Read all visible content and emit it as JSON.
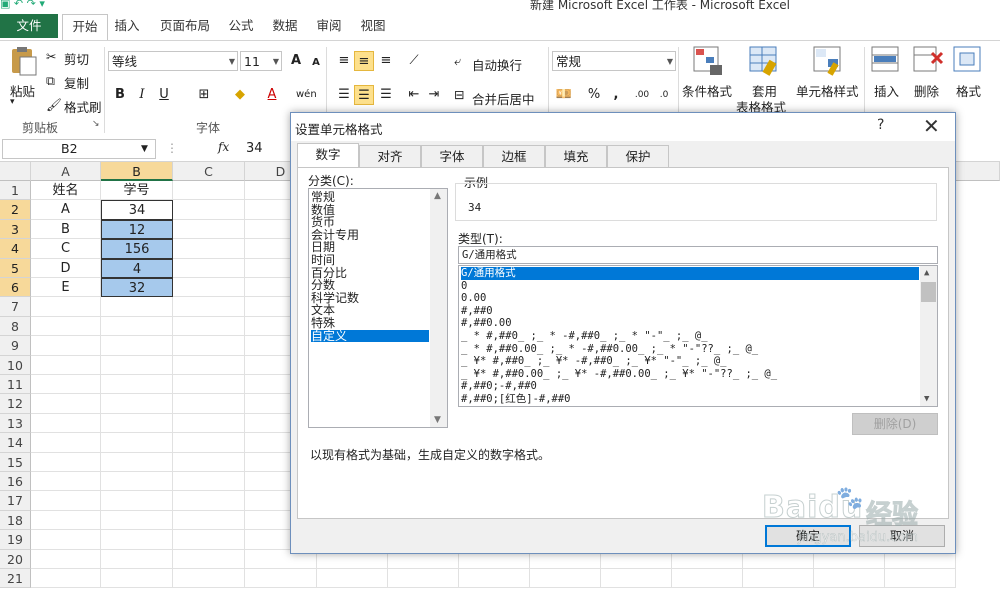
{
  "window": {
    "title": "新建 Microsoft Excel 工作表 - Microsoft Excel"
  },
  "tabs": [
    "文件",
    "开始",
    "插入",
    "页面布局",
    "公式",
    "数据",
    "审阅",
    "视图"
  ],
  "ribbon": {
    "clipboard": {
      "paste": "粘贴",
      "cut": "剪切",
      "copy": "复制",
      "format_painter": "格式刷",
      "group": "剪贴板"
    },
    "font": {
      "name": "等线",
      "size": "11",
      "bold": "B",
      "italic": "I",
      "underline": "U",
      "grow": "A",
      "shrink": "A",
      "font_color": "A",
      "phonetic": "wén",
      "group": "字体"
    },
    "alignment": {
      "wrap": "自动换行",
      "merge": "合并后居中"
    },
    "number": {
      "format": "常规",
      "percent": "%",
      "comma": ","
    },
    "styles": {
      "conditional": "条件格式",
      "table_line1": "套用",
      "table_line2": "表格格式",
      "cell_styles": "单元格样式"
    },
    "cells": {
      "insert": "插入",
      "delete": "删除",
      "format": "格式"
    }
  },
  "formula_bar": {
    "name_box": "B2",
    "fx": "fx",
    "value": "34"
  },
  "sheet": {
    "columns": [
      "A",
      "B",
      "C",
      "D"
    ],
    "rows": [
      "1",
      "2",
      "3",
      "4",
      "5",
      "6",
      "7",
      "8",
      "9",
      "10",
      "11",
      "12",
      "13",
      "14",
      "15",
      "16",
      "17",
      "18",
      "19",
      "20",
      "21"
    ],
    "cells": [
      [
        "姓名",
        "学号"
      ],
      [
        "A",
        "34"
      ],
      [
        "B",
        "12"
      ],
      [
        "C",
        "156"
      ],
      [
        "D",
        "4"
      ],
      [
        "E",
        "32"
      ]
    ]
  },
  "dialog": {
    "title": "设置单元格格式",
    "help": "?",
    "close": "✕",
    "tabs": [
      "数字",
      "对齐",
      "字体",
      "边框",
      "填充",
      "保护"
    ],
    "category_label": "分类(C):",
    "categories": [
      "常规",
      "数值",
      "货币",
      "会计专用",
      "日期",
      "时间",
      "百分比",
      "分数",
      "科学记数",
      "文本",
      "特殊",
      "自定义"
    ],
    "selected_category": "自定义",
    "sample_label": "示例",
    "sample_value": "34",
    "type_label": "类型(T):",
    "type_value": "G/通用格式",
    "formats": [
      "G/通用格式",
      "0",
      "0.00",
      "#,##0",
      "#,##0.00",
      "_ * #,##0_ ;_ * -#,##0_ ;_ * \"-\"_ ;_ @_",
      "_ * #,##0.00_ ;_ * -#,##0.00_ ;_ * \"-\"??_ ;_ @_",
      "_ ¥* #,##0_ ;_ ¥* -#,##0_ ;_ ¥* \"-\"_ ;_ @_",
      "_ ¥* #,##0.00_ ;_ ¥* -#,##0.00_ ;_ ¥* \"-\"??_ ;_ @_",
      "#,##0;-#,##0",
      "#,##0;[红色]-#,##0"
    ],
    "delete_button": "删除(D)",
    "description": "以现有格式为基础，生成自定义的数字格式。",
    "ok": "确定",
    "cancel": "取消"
  },
  "watermark": {
    "brand": "Baidu",
    "cn": "经验",
    "url": "jingyan.baidu.com"
  },
  "colors": {
    "excel_green": "#217346",
    "selection_blue": "#0078d7",
    "cell_fill": "#a6c9ec",
    "header_highlight": "#f7d99a"
  }
}
